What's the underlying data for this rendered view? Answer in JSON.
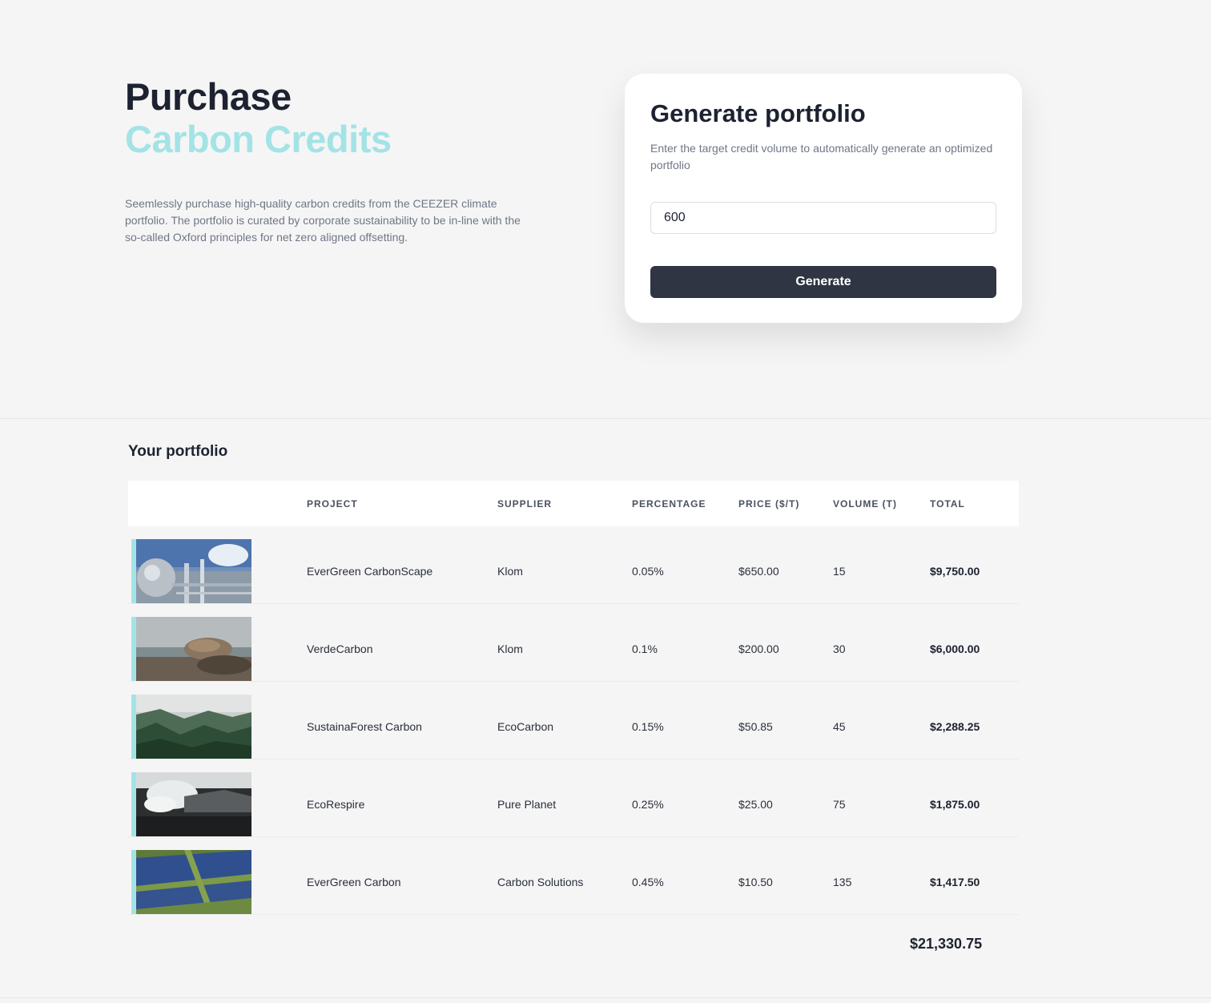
{
  "hero": {
    "title_line1": "Purchase",
    "title_line2": "Carbon Credits",
    "description": "Seemlessly purchase high-quality carbon credits from the CEEZER climate portfolio. The portfolio is curated by corporate sustainability to be in-line with the so-called Oxford principles for net zero aligned offsetting.",
    "accent_color": "#a3e3e6"
  },
  "generator": {
    "title": "Generate portfolio",
    "description": "Enter the target credit volume to automatically generate an optimized portfolio",
    "input_value": "600",
    "button_label": "Generate",
    "button_color": "#2f3542"
  },
  "portfolio": {
    "title": "Your portfolio",
    "columns": [
      "PROJECT",
      "SUPPLIER",
      "PERCENTAGE",
      "PRICE ($/T)",
      "VOLUME (T)",
      "TOTAL"
    ],
    "rows": [
      {
        "image": "industrial-plant",
        "project": "EverGreen CarbonScape",
        "supplier": "Klom",
        "percentage": "0.05%",
        "price": "$650.00",
        "volume": "15",
        "total": "$9,750.00"
      },
      {
        "image": "coastal-rock",
        "project": "VerdeCarbon",
        "supplier": "Klom",
        "percentage": "0.1%",
        "price": "$200.00",
        "volume": "30",
        "total": "$6,000.00"
      },
      {
        "image": "misty-forest",
        "project": "SustainaForest Carbon",
        "supplier": "EcoCarbon",
        "percentage": "0.15%",
        "price": "$50.85",
        "volume": "45",
        "total": "$2,288.25"
      },
      {
        "image": "volcanic-steam",
        "project": "EcoRespire",
        "supplier": "Pure Planet",
        "percentage": "0.25%",
        "price": "$25.00",
        "volume": "75",
        "total": "$1,875.00"
      },
      {
        "image": "solar-field",
        "project": "EverGreen Carbon",
        "supplier": "Carbon Solutions",
        "percentage": "0.45%",
        "price": "$10.50",
        "volume": "135",
        "total": "$1,417.50"
      }
    ],
    "grand_total": "$21,330.75"
  }
}
